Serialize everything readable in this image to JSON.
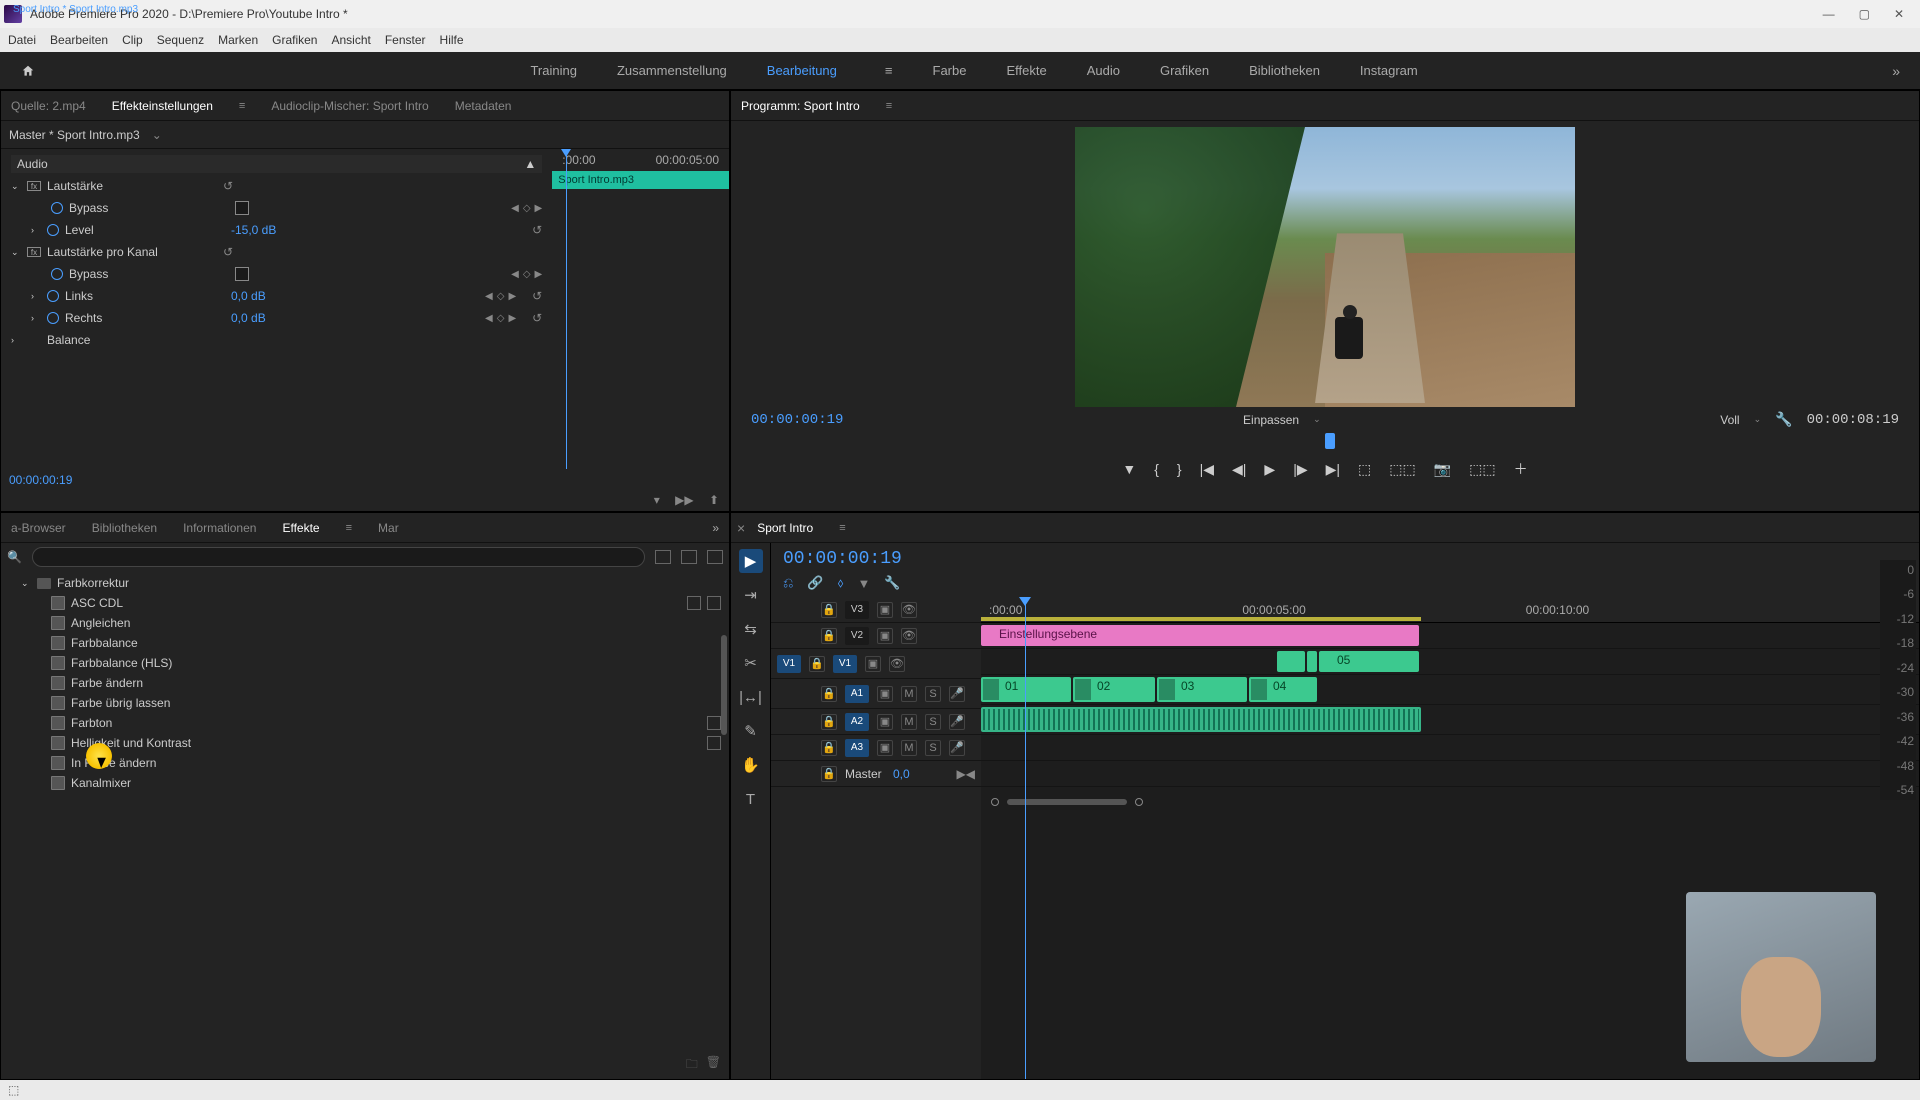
{
  "window": {
    "title": "Adobe Premiere Pro 2020 - D:\\Premiere Pro\\Youtube Intro *"
  },
  "menu": [
    "Datei",
    "Bearbeiten",
    "Clip",
    "Sequenz",
    "Marken",
    "Grafiken",
    "Ansicht",
    "Fenster",
    "Hilfe"
  ],
  "workspaces": {
    "items": [
      "Training",
      "Zusammenstellung",
      "Bearbeitung",
      "Farbe",
      "Effekte",
      "Audio",
      "Grafiken",
      "Bibliotheken",
      "Instagram"
    ],
    "active": "Bearbeitung"
  },
  "source_panel": {
    "tabs": [
      "Quelle: 2.mp4",
      "Effekteinstellungen",
      "Audioclip-Mischer: Sport Intro",
      "Metadaten"
    ],
    "active": "Effekteinstellungen",
    "master": "Master * Sport Intro.mp3",
    "clip": "Sport Intro * Sport Intro.mp3",
    "clip_bar_label": "Sport Intro.mp3",
    "ruler": {
      "t0": ":00:00",
      "t1": "00:00:05:00"
    },
    "groups": {
      "audio": "Audio",
      "lautstaerke": {
        "name": "Lautstärke",
        "bypass": {
          "label": "Bypass"
        },
        "level": {
          "label": "Level",
          "value": "-15,0 dB"
        }
      },
      "kanal": {
        "name": "Lautstärke pro Kanal",
        "bypass": {
          "label": "Bypass"
        },
        "links": {
          "label": "Links",
          "value": "0,0 dB"
        },
        "rechts": {
          "label": "Rechts",
          "value": "0,0 dB"
        }
      },
      "balance": {
        "name": "Balance"
      }
    },
    "timecode": "00:00:00:19"
  },
  "program": {
    "title": "Programm: Sport Intro",
    "timecode": "00:00:00:19",
    "fit": "Einpassen",
    "quality": "Voll",
    "duration": "00:00:08:19"
  },
  "effects_panel": {
    "tabs": [
      "a-Browser",
      "Bibliotheken",
      "Informationen",
      "Effekte",
      "Mar"
    ],
    "active": "Effekte",
    "root": "Farbkorrektur",
    "items": [
      {
        "label": "ASC CDL",
        "badges": 2
      },
      {
        "label": "Angleichen",
        "badges": 0
      },
      {
        "label": "Farbbalance",
        "badges": 0
      },
      {
        "label": "Farbbalance (HLS)",
        "badges": 0
      },
      {
        "label": "Farbe ändern",
        "badges": 0
      },
      {
        "label": "Farbe übrig lassen",
        "badges": 0
      },
      {
        "label": "Farbton",
        "badges": 1
      },
      {
        "label": "Helligkeit und Kontrast",
        "badges": 1
      },
      {
        "label": "In Farbe ändern",
        "badges": 0
      },
      {
        "label": "Kanalmixer",
        "badges": 0
      }
    ]
  },
  "timeline": {
    "sequence": "Sport Intro",
    "timecode": "00:00:00:19",
    "ruler": [
      ":00:00",
      "00:00:05:00",
      "00:00:10:00"
    ],
    "tracks": {
      "v3": "V3",
      "v2": "V2",
      "v1": "V1",
      "a1": "A1",
      "a2": "A2",
      "a3": "A3",
      "master": "Master",
      "master_val": "0,0"
    },
    "clips": {
      "adj": "Einstellungsebene",
      "v2_05": "05",
      "v1": [
        "01",
        "02",
        "03",
        "04"
      ]
    }
  },
  "meter_scale": [
    "0",
    "-6",
    "-12",
    "-18",
    "-24",
    "-30",
    "-36",
    "-42",
    "-48",
    "-54"
  ]
}
